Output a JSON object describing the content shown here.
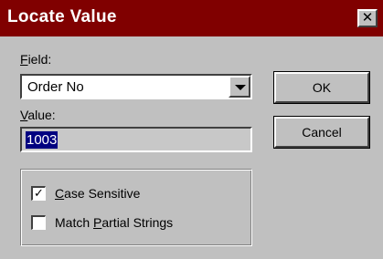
{
  "window": {
    "title": "Locate Value",
    "close_glyph": "✕"
  },
  "field": {
    "label_first": "F",
    "label_rest": "ield:",
    "selected": "Order No"
  },
  "value": {
    "label_first": "V",
    "label_rest": "alue:",
    "text": "1003"
  },
  "buttons": {
    "ok": "OK",
    "cancel": "Cancel"
  },
  "options": {
    "case_sensitive": {
      "label_first": "C",
      "label_rest": "ase Sensitive",
      "checked": true,
      "mark": "✓"
    },
    "match_partial": {
      "label_before": "Match ",
      "label_ul": "P",
      "label_rest": "artial Strings",
      "checked": false,
      "mark": ""
    }
  },
  "colors": {
    "titlebar": "#800000",
    "face": "#c0c0c0",
    "selection": "#000080"
  }
}
